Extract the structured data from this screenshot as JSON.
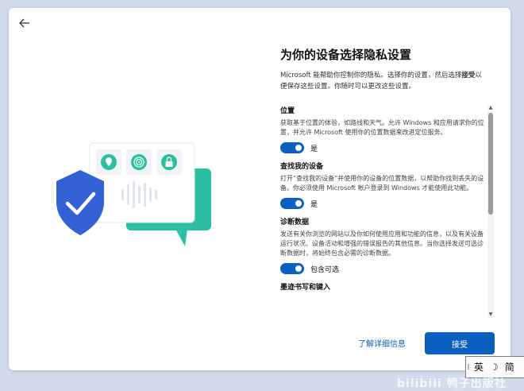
{
  "window": {
    "back_button": "back-arrow-icon"
  },
  "page": {
    "title": "为你的设备选择隐私设置",
    "intro_part1": "Microsoft 能帮助你控制你的隐私。选择你的设置，然后选择",
    "intro_accept_word": "接受",
    "intro_part2": "以便保存这些设置。你随时可以更改这些设置。"
  },
  "settings": [
    {
      "title": "位置",
      "description": "获取基于位置的体验，如路线和天气。允许 Windows 和应用请求你的位置，并允许 Microsoft 使用你的位置数据来改进定位服务。",
      "toggle_state": "是",
      "enabled": true
    },
    {
      "title": "查找我的设备",
      "description": "打开“查找我的设备”并使用你的设备的位置数据，以帮助你找到丢失的设备。你必须使用 Microsoft 帐户登录到 Windows 才能使用此功能。",
      "toggle_state": "是",
      "enabled": true
    },
    {
      "title": "诊断数据",
      "description": "发送有关你浏览的网站以及你如何使用应用和功能的信息，以及有关设备运行状况、设备活动和增强的错误报告的其他信息。当你选择发送可选诊断数据时，将始终包含必需的诊断数据。",
      "toggle_state": "包含可选",
      "enabled": true
    },
    {
      "title": "墨迹书写和键入"
    }
  ],
  "footer": {
    "learn_more": "了解详细信息",
    "accept": "接受"
  },
  "ime": {
    "handle": "⁞",
    "language": "英",
    "mode_icon": "moon-icon",
    "mode_glyph": "☽",
    "extra": "简"
  },
  "watermark": "bilibili 鸭子出版社",
  "colors": {
    "accent": "#0a5fbf",
    "background": "#d2dced",
    "shield": "#3461d6",
    "chat_bubble": "#2bbfa0"
  }
}
